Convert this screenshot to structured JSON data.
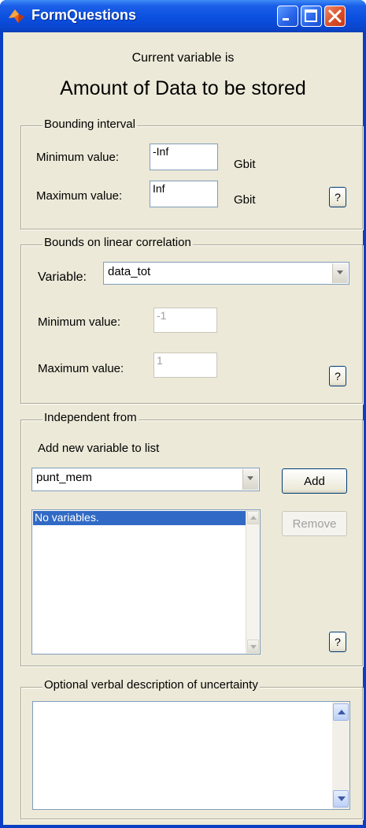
{
  "window": {
    "title": "FormQuestions",
    "icon": "matlab-icon",
    "controls": [
      "minimize-icon",
      "maximize-icon",
      "close-icon"
    ]
  },
  "header": {
    "caption": "Current variable is",
    "variable_name": "Amount of Data to be stored"
  },
  "bounding_interval": {
    "legend": "Bounding interval",
    "min_label": "Minimum value:",
    "min_value": "-Inf",
    "min_unit": "Gbit",
    "max_label": "Maximum value:",
    "max_value": "Inf",
    "max_unit": "Gbit",
    "help_label": "?"
  },
  "linear_correlation": {
    "legend": "Bounds on linear correlation",
    "variable_label": "Variable:",
    "variable_selected": "data_tot",
    "min_label": "Minimum value:",
    "min_value": "-1",
    "max_label": "Maximum value:",
    "max_value": "1",
    "help_label": "?"
  },
  "independent_from": {
    "legend": "Independent from",
    "add_caption": "Add new variable to list",
    "variable_selected": "punt_mem",
    "add_button": "Add",
    "remove_button": "Remove",
    "list_items": [
      "No variables."
    ],
    "help_label": "?"
  },
  "verbal_description": {
    "legend": "Optional verbal description of uncertainty",
    "value": ""
  },
  "colors": {
    "titlebar": "#0b4fdf",
    "client_bg": "#ece9d8",
    "selection": "#316ac5",
    "close_button": "#d84a24"
  }
}
